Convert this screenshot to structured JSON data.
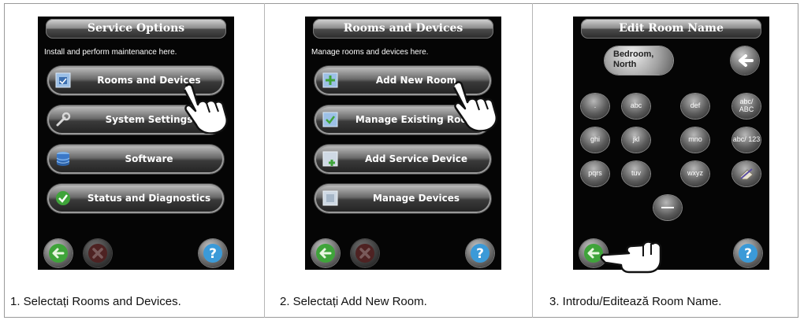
{
  "panels": [
    {
      "title": "Service Options",
      "subtitle": "Install and perform maintenance here.",
      "buttons": [
        {
          "label": "Rooms and Devices",
          "icon": "room-devices-icon"
        },
        {
          "label": "System Settings",
          "icon": "wrench-icon"
        },
        {
          "label": "Software",
          "icon": "database-icon"
        },
        {
          "label": "Status and Diagnostics",
          "icon": "check-icon"
        }
      ],
      "caption": "1. Selectați Rooms and Devices."
    },
    {
      "title": "Rooms and Devices",
      "subtitle": "Manage rooms and devices here.",
      "buttons": [
        {
          "label": "Add New Room",
          "icon": "add-room-icon"
        },
        {
          "label": "Manage Existing Room",
          "icon": "manage-room-icon"
        },
        {
          "label": "Add Service Device",
          "icon": "add-device-icon"
        },
        {
          "label": "Manage Devices",
          "icon": "manage-devices-icon"
        }
      ],
      "caption": "2. Selectați Add New Room."
    },
    {
      "title": "Edit Room Name",
      "name_value_line1": "Bedroom,",
      "name_value_line2": "North",
      "keys": [
        ".",
        "abc",
        "def",
        "abc/ ABC",
        "ghi",
        "jkl",
        "mno",
        "abc/ 123",
        "pqrs",
        "tuv",
        "wxyz"
      ],
      "caption": "3. Introdu/Editează Room Name."
    }
  ],
  "colors": {
    "accent_green": "#3fa43a",
    "help_blue": "#3b9ad8",
    "cancel_red": "#8a3a3a"
  }
}
